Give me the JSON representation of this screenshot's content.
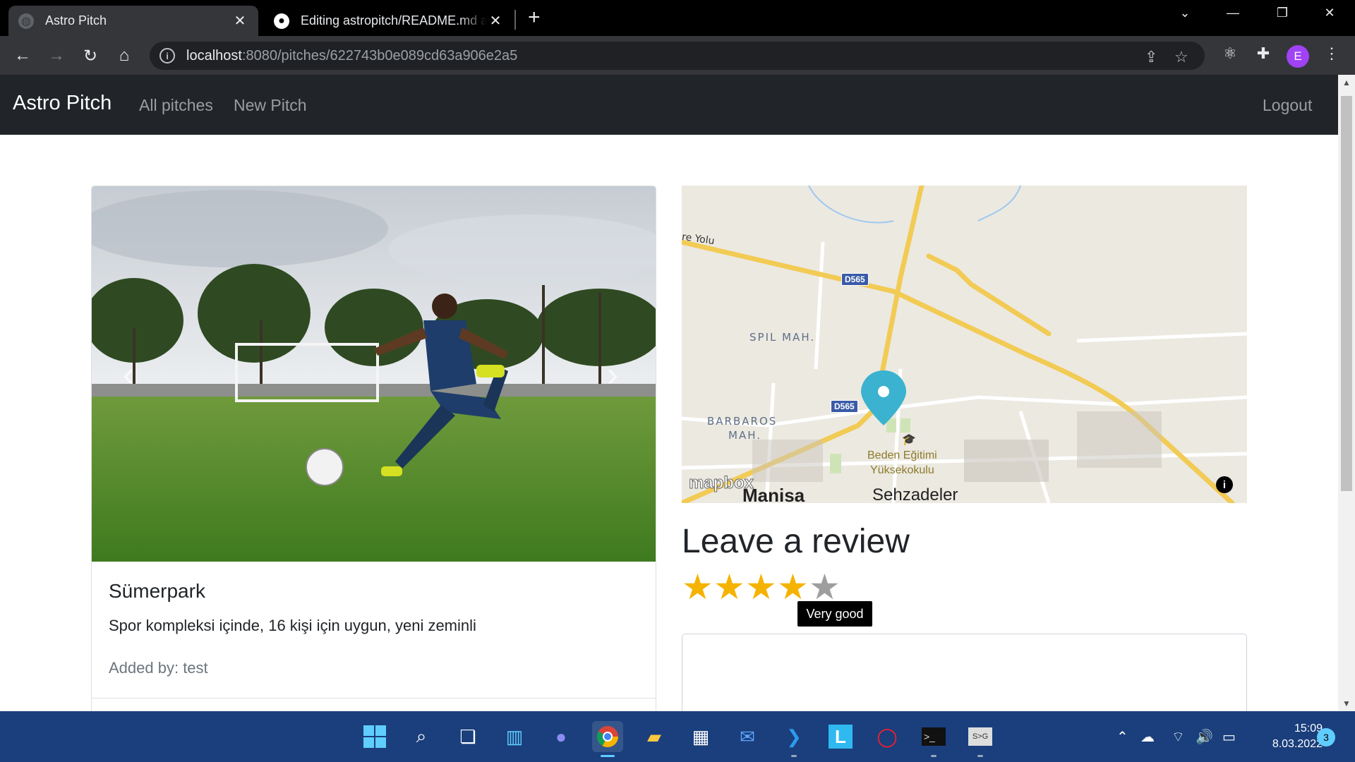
{
  "browser": {
    "tabs": [
      {
        "title": "Astro Pitch",
        "active": true
      },
      {
        "title": "Editing astropitch/README.md at",
        "active": false
      }
    ],
    "url_host": "localhost",
    "url_path": ":8080/pitches/622743b0e089cd63a906e2a5",
    "profile_initial": "E"
  },
  "navbar": {
    "brand": "Astro Pitch",
    "links": [
      "All pitches",
      "New Pitch"
    ],
    "logout": "Logout"
  },
  "pitch": {
    "title": "Sümerpark",
    "description": "Spor kompleksi içinde, 16 kişi için uygun, yeni zeminli",
    "added_by": "Added by: test"
  },
  "map": {
    "labels": {
      "road": "re Yolu",
      "spil": "SPIL MAH.",
      "barbaros_1": "BARBAROS",
      "barbaros_2": "MAH.",
      "poi_1": "Beden Eğitimi",
      "poi_2": "Yüksekokulu",
      "city_1": "Manisa",
      "city_2": "Sehzadeler",
      "logo": "mapbox"
    },
    "shields": [
      "D565",
      "D565"
    ]
  },
  "review": {
    "heading": "Leave a review",
    "rating": 4,
    "max_rating": 5,
    "tooltip": "Very good"
  },
  "taskbar": {
    "time": "15:09",
    "date": "8.03.2022",
    "notifications": "3"
  },
  "colors": {
    "navbar_bg": "#212529",
    "star_filled": "#f5b301",
    "star_empty": "#9e9e9e",
    "taskbar_bg": "#1a3f7c"
  }
}
